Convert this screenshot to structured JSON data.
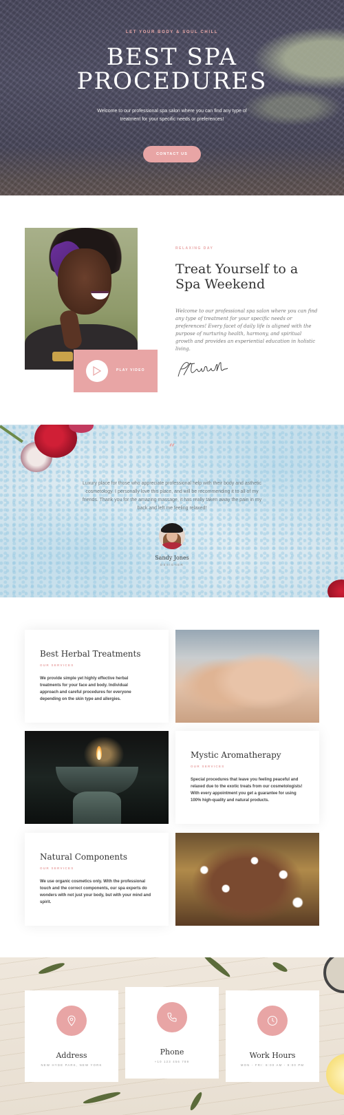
{
  "hero": {
    "tagline": "LET YOUR BODY & SOUL CHILL",
    "title_line1": "BEST SPA",
    "title_line2": "PROCEDURES",
    "description": "Welcome to our professional spa salon where you can find any type of treatment for your specific needs or preferences!",
    "cta_label": "CONTACT US",
    "accent_color": "#e8a5a5"
  },
  "about": {
    "tag": "RELAXING DAY",
    "title": "Treat Yourself to a Spa Weekend",
    "text": "Welcome to our professional spa salon where you can find any type of treatment for your specific needs or preferences! Every facet of daily life is aligned with the purpose of nurturing health, harmony, and spiritual growth and provides an experiential education in holistic living.",
    "play_label": "PLAY VIDEO",
    "signature": "P.Turberville"
  },
  "testimonial": {
    "quote_mark": "“",
    "text": "Luxury place for those who appreciate professional help with their body and asthetic cosmetology. I personally love this place, and will be recommending it to all of my friends. Thank you for the amazing massage, it has really taken away the pain in my back and left me feeling relaxed!",
    "name": "Sandy Jones",
    "role": "DESIGNER"
  },
  "services": [
    {
      "title": "Best Herbal Treatments",
      "subtitle": "OUR SERVICES",
      "text": "We provide simple yet highly effective herbal treatments for your face and body. Individual approach and careful procedures for everyone depending on the skin type and allergies."
    },
    {
      "title": "Mystic Aromatherapy",
      "subtitle": "OUR SERVICES",
      "text": "Special procedures that leave you feeling peaceful and relaxed due to the exotic treats from our cosmetologists! With every appointment you get a guarantee for using 100% high-quality and natural products."
    },
    {
      "title": "Natural Components",
      "subtitle": "OUR SERVICES",
      "text": "We use organic cosmetics only. With the professional touch and the correct components, our spa experts do wonders with not just your body, but with your mind and spirit."
    }
  ],
  "contact": [
    {
      "title": "Address",
      "subtitle": "NEW HYDE PARK, NEW YORK",
      "icon": "map-pin-icon"
    },
    {
      "title": "Phone",
      "subtitle": "+10 123 456 789",
      "icon": "phone-icon"
    },
    {
      "title": "Work Hours",
      "subtitle": "MON - FRI: 8:00 AM - 9:00 PM",
      "icon": "clock-icon"
    }
  ]
}
